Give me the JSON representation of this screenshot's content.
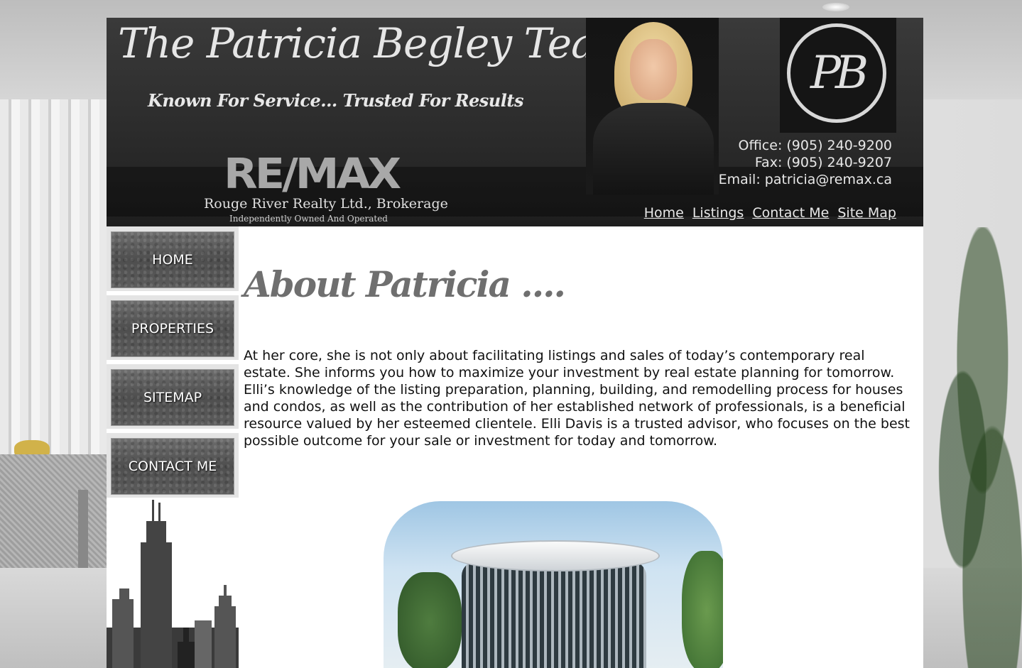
{
  "header": {
    "team_title": "The Patricia Begley Team",
    "tagline": "Known For Service... Trusted For Results",
    "brand_logo_text": "RE/MAX",
    "brokerage": "Rouge River Realty Ltd., Brokerage",
    "brokerage_note": "Independently Owned And Operated",
    "monogram": "PB",
    "office": "Office: (905) 240-9200",
    "fax": "Fax: (905) 240-9207",
    "email": "Email: patricia@remax.ca",
    "nav": [
      "Home",
      "Listings",
      "Contact Me",
      "Site Map"
    ]
  },
  "sidebar": {
    "items": [
      {
        "label": "HOME"
      },
      {
        "label": "PROPERTIES"
      },
      {
        "label": "SITEMAP"
      },
      {
        "label": "CONTACT ME"
      }
    ]
  },
  "main": {
    "heading": "About Patricia ....",
    "body": "At her core, she is not only about facilitating listings and sales of today’s contemporary real estate. She informs you how to maximize your investment by real estate planning for tomorrow. Elli’s knowledge of the listing preparation, planning, building, and remodelling process for houses and condos, as well as the contribution of her established network of professionals, is a beneficial resource valued by her esteemed clientele. Elli Davis is a trusted advisor, who focuses on the best possible outcome for your sale or investment for today and tomorrow."
  },
  "colors": {
    "header_bg": "#2a2a2a",
    "heading_gray": "#6f6f6f",
    "nav_button": "#5a5a5a"
  }
}
